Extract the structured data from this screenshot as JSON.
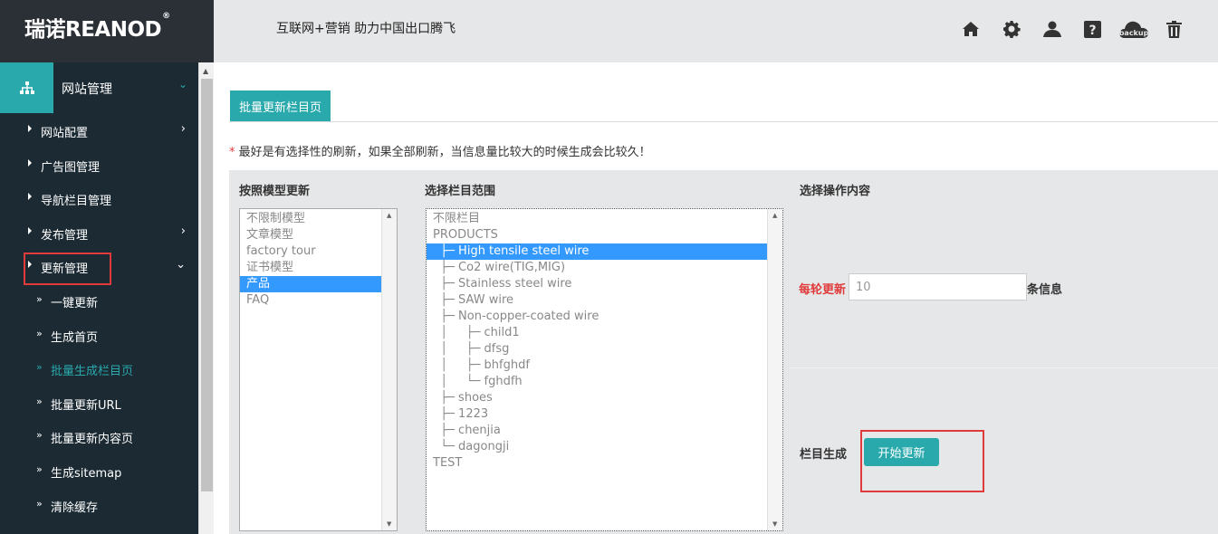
{
  "brand": {
    "logo_text": "瑞诺REANOD",
    "logo_mark": "®",
    "slogan": "互联网+营销 助力中国出口腾飞"
  },
  "top_icons": [
    "home-icon",
    "gear-icon",
    "user-icon",
    "help-icon",
    "backup-cloud-icon",
    "trash-icon"
  ],
  "backup_label": "backup",
  "sidebar": {
    "header": "网站管理",
    "items": [
      {
        "label": "网站配置",
        "has_chevron": true,
        "chevron": "›"
      },
      {
        "label": "广告图管理"
      },
      {
        "label": "导航栏目管理"
      },
      {
        "label": "发布管理",
        "chevron": "›"
      },
      {
        "label": "更新管理",
        "chevron": "⌄"
      }
    ],
    "subitems": [
      {
        "label": "一键更新"
      },
      {
        "label": "生成首页"
      },
      {
        "label": "批量生成栏目页",
        "active": true
      },
      {
        "label": "批量更新URL"
      },
      {
        "label": "批量更新内容页"
      },
      {
        "label": "生成sitemap"
      },
      {
        "label": "清除缓存"
      }
    ],
    "sub_arrow": "»"
  },
  "main": {
    "tab_label": "批量更新栏目页",
    "notice_star": "*",
    "notice": "最好是有选择性的刷新，如果全部刷新，当信息量比较大的时候生成会比较久！",
    "col1_header": "按照模型更新",
    "col2_header": "选择栏目范围",
    "col3_header": "选择操作内容",
    "models": [
      "不限制模型",
      "文章模型",
      "factory tour",
      "证书模型",
      "产品",
      "FAQ"
    ],
    "models_selected_index": 4,
    "categories": [
      "不限栏目",
      "PRODUCTS",
      "  ├─ High tensile steel wire",
      "  ├─ Co2 wire(TIG,MIG)",
      "  ├─ Stainless steel wire",
      "  ├─ SAW wire",
      "  ├─ Non-copper-coated wire",
      "  │     ├─ child1",
      "  │     ├─ dfsg",
      "  │     ├─ bhfghdf",
      "  │     └─ fghdfh",
      "  ├─ shoes",
      "  ├─ 1223",
      "  ├─ chenjia",
      "  └─ dagongji",
      "TEST"
    ],
    "categories_selected_index": 2,
    "per_round_label": "每轮更新",
    "per_round_value": "10",
    "per_round_suffix": "条信息",
    "generate_label": "栏目生成",
    "start_button": "开始更新"
  },
  "colors": {
    "accent": "#2aa9ad",
    "sidebar_bg": "#1b2a33",
    "highlight_red": "#e03a3a",
    "selection_blue": "#3399ff"
  }
}
